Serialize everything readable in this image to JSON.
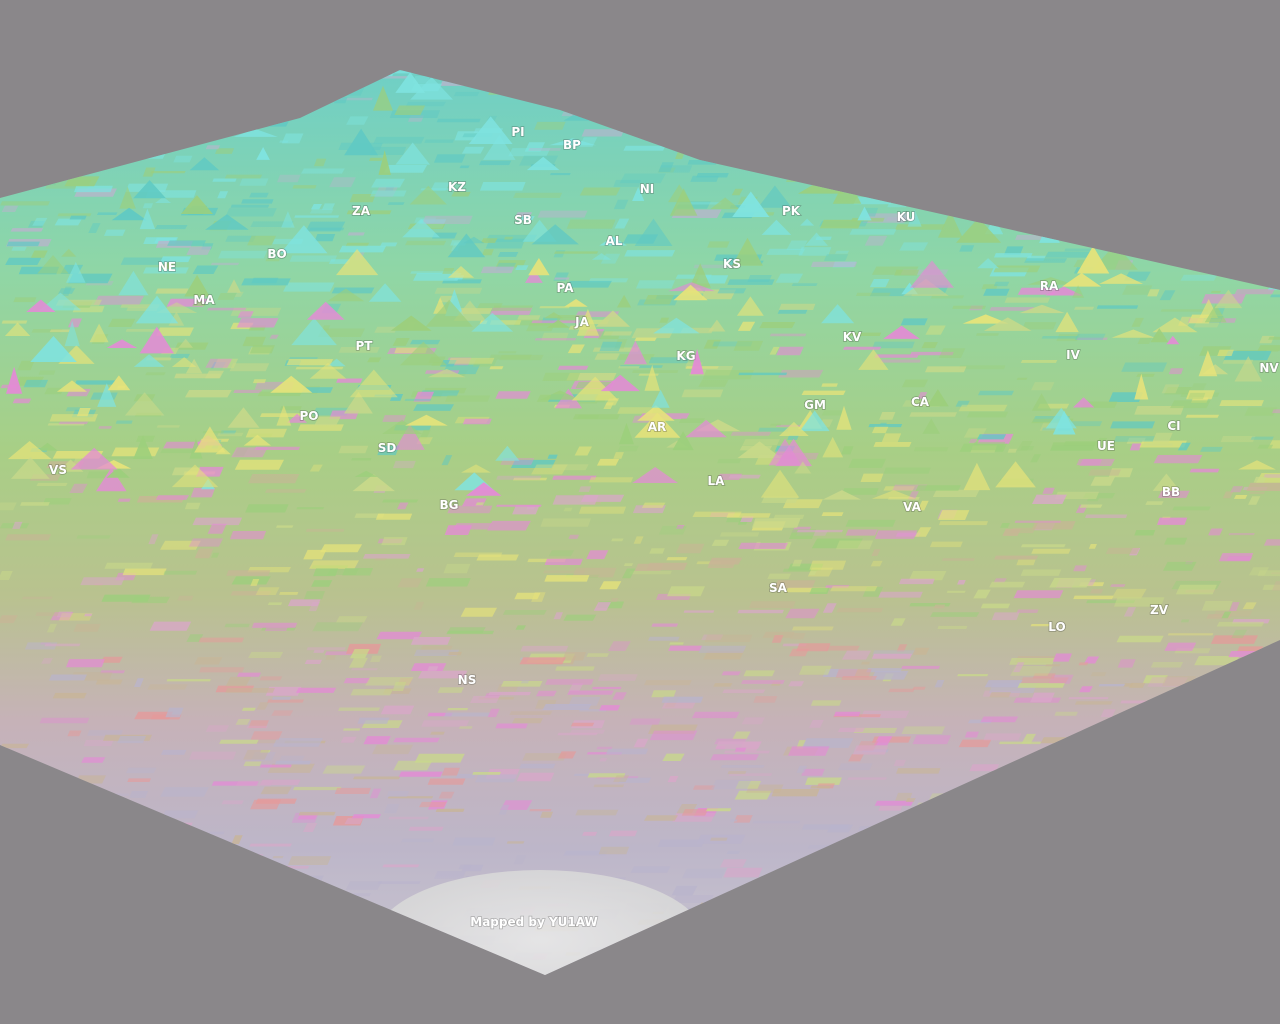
{
  "map": {
    "credit": "Mapped by YU1AW",
    "background_color": "#8a878a",
    "palette": [
      "#5fc9c3",
      "#7fe3e0",
      "#9ccf7c",
      "#c9d98a",
      "#e6e37a",
      "#d9a7c9",
      "#e48ad6",
      "#e59a9a",
      "#b9b4cc",
      "#c8b596"
    ],
    "sites": [
      {
        "code": "PI"
      },
      {
        "code": "BP"
      },
      {
        "code": "KZ"
      },
      {
        "code": "NI"
      },
      {
        "code": "ZA"
      },
      {
        "code": "SB"
      },
      {
        "code": "PK"
      },
      {
        "code": "KU"
      },
      {
        "code": "AL"
      },
      {
        "code": "BO"
      },
      {
        "code": "NE"
      },
      {
        "code": "KS"
      },
      {
        "code": "PA"
      },
      {
        "code": "RA"
      },
      {
        "code": "MA"
      },
      {
        "code": "JA"
      },
      {
        "code": "KV"
      },
      {
        "code": "PT"
      },
      {
        "code": "KG"
      },
      {
        "code": "IV"
      },
      {
        "code": "NV"
      },
      {
        "code": "GM"
      },
      {
        "code": "CA"
      },
      {
        "code": "PO"
      },
      {
        "code": "CI"
      },
      {
        "code": "AR"
      },
      {
        "code": "SD"
      },
      {
        "code": "UE"
      },
      {
        "code": "VS"
      },
      {
        "code": "LA"
      },
      {
        "code": "BB"
      },
      {
        "code": "BG"
      },
      {
        "code": "VA"
      },
      {
        "code": "SA"
      },
      {
        "code": "ZV"
      },
      {
        "code": "LO"
      },
      {
        "code": "NS"
      }
    ]
  }
}
